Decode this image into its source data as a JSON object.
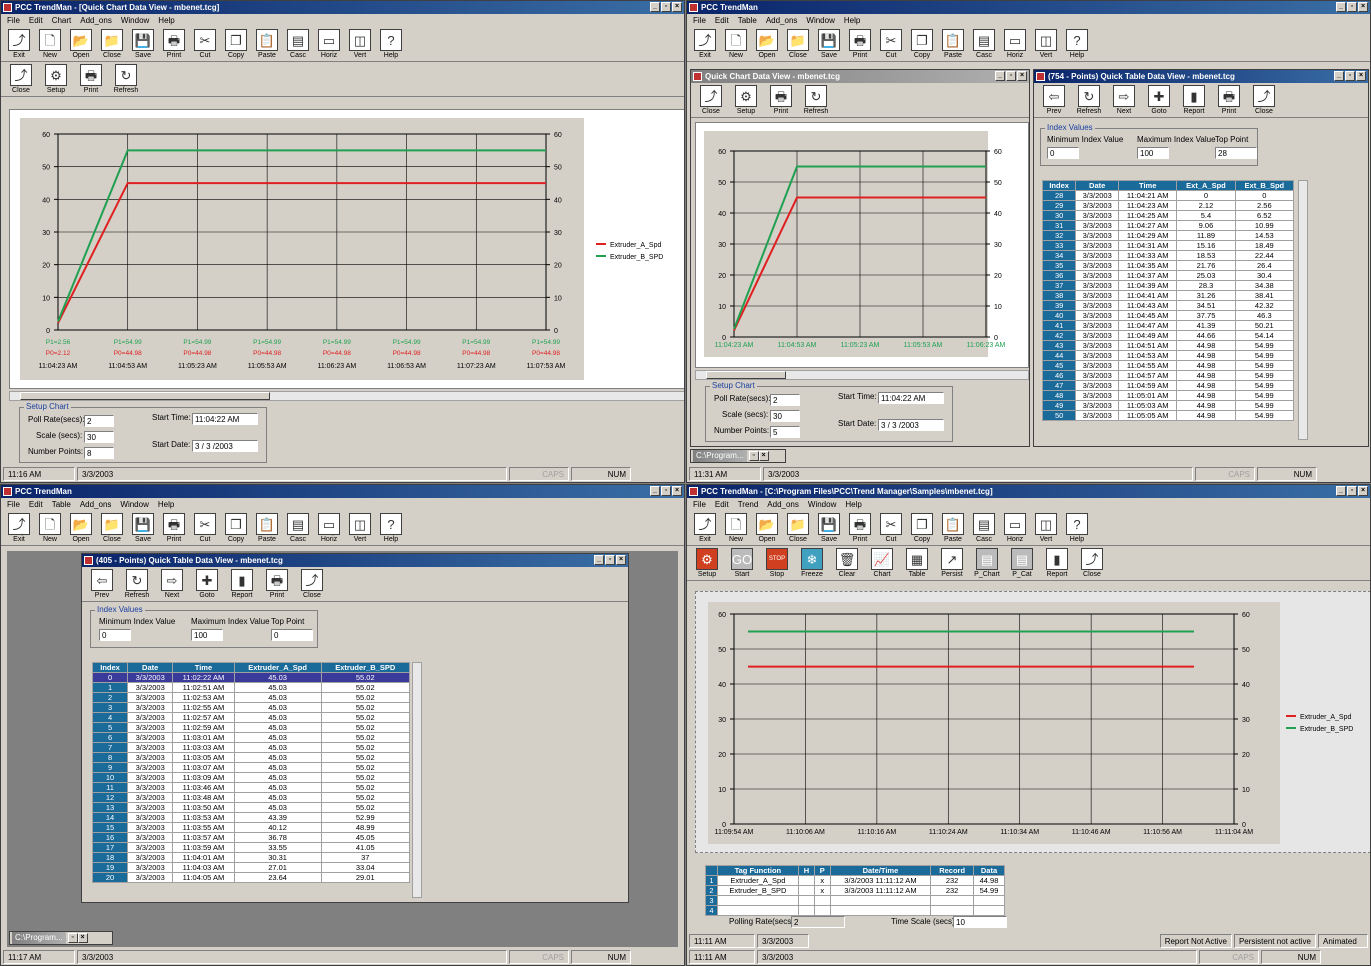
{
  "colors": {
    "series_a": "#e02020",
    "series_b": "#20a050",
    "accent": "#0a246a",
    "grid_header": "#1a6a9a"
  },
  "menus": {
    "q1": [
      "File",
      "Edit",
      "Chart",
      "Add_ons",
      "Window",
      "Help"
    ],
    "q2": [
      "File",
      "Edit",
      "Table",
      "Add_ons",
      "Window",
      "Help"
    ],
    "q3": [
      "File",
      "Edit",
      "Table",
      "Add_ons",
      "Window",
      "Help"
    ],
    "q4": [
      "File",
      "Edit",
      "Trend",
      "Add_ons",
      "Window",
      "Help"
    ]
  },
  "main_toolbar": [
    {
      "label": "Exit",
      "icon": "exit-icon",
      "glyph": "⤴"
    },
    {
      "label": "New",
      "icon": "new-icon",
      "glyph": "🗋"
    },
    {
      "label": "Open",
      "icon": "open-icon",
      "glyph": "📂"
    },
    {
      "label": "Close",
      "icon": "close-doc-icon",
      "glyph": "📁"
    },
    {
      "label": "Save",
      "icon": "save-icon",
      "glyph": "💾"
    },
    {
      "label": "Print",
      "icon": "print-icon",
      "glyph": "🖶"
    },
    {
      "label": "Cut",
      "icon": "cut-icon",
      "glyph": "✂"
    },
    {
      "label": "Copy",
      "icon": "copy-icon",
      "glyph": "❐"
    },
    {
      "label": "Paste",
      "icon": "paste-icon",
      "glyph": "📋"
    },
    {
      "label": "Casc",
      "icon": "cascade-icon",
      "glyph": "▤"
    },
    {
      "label": "Horiz",
      "icon": "tile-horizontal-icon",
      "glyph": "▭"
    },
    {
      "label": "Vert",
      "icon": "tile-vertical-icon",
      "glyph": "◫"
    },
    {
      "label": "Help",
      "icon": "help-icon",
      "glyph": "?"
    }
  ],
  "q1": {
    "title": "PCC TrendMan - [Quick Chart Data View - mbenet.tcg]",
    "chart_toolbar": [
      {
        "label": "Close",
        "icon": "close-icon",
        "glyph": "⤴"
      },
      {
        "label": "Setup",
        "icon": "setup-icon",
        "glyph": "⚙"
      },
      {
        "label": "Print",
        "icon": "print-icon",
        "glyph": "🖶"
      },
      {
        "label": "Refresh",
        "icon": "refresh-icon",
        "glyph": "↻"
      }
    ],
    "setup": {
      "legend": "Setup Chart",
      "poll_label": "Poll Rate(secs):",
      "poll": "2",
      "scale_label": "Scale (secs):",
      "scale": "30",
      "points_label": "Number Points:",
      "points": "8",
      "start_time_label": "Start Time:",
      "start_time": "11:04:22 AM",
      "start_date_label": "Start Date:",
      "start_date": "3 / 3 /2003"
    },
    "status": {
      "time": "11:16 AM",
      "date": "3/3/2003",
      "caps": "CAPS",
      "num": "NUM"
    }
  },
  "q2": {
    "title": "PCC TrendMan",
    "child_chart_title": "Quick Chart Data View - mbenet.tcg",
    "child_table_title": "(754 - Points) Quick Table Data View - mbenet.tcg",
    "chart_toolbar": [
      {
        "label": "Close",
        "icon": "close-icon",
        "glyph": "⤴"
      },
      {
        "label": "Setup",
        "icon": "setup-icon",
        "glyph": "⚙"
      },
      {
        "label": "Print",
        "icon": "print-icon",
        "glyph": "🖶"
      },
      {
        "label": "Refresh",
        "icon": "refresh-icon",
        "glyph": "↻"
      }
    ],
    "table_toolbar": [
      {
        "label": "Prev",
        "icon": "prev-arrow-icon",
        "glyph": "⇦"
      },
      {
        "label": "Refresh",
        "icon": "refresh-icon",
        "glyph": "↻"
      },
      {
        "label": "Next",
        "icon": "next-arrow-icon",
        "glyph": "⇨"
      },
      {
        "label": "Goto",
        "icon": "goto-icon",
        "glyph": "✚"
      },
      {
        "label": "Report",
        "icon": "report-icon",
        "glyph": "▮"
      },
      {
        "label": "Print",
        "icon": "print-icon",
        "glyph": "🖶"
      },
      {
        "label": "Close",
        "icon": "close-icon",
        "glyph": "⤴"
      }
    ],
    "index": {
      "legend": "Index Values",
      "min_label": "Minimum Index Value",
      "min": "0",
      "max_label": "Maximum Index Value",
      "max": "100",
      "top_label": "Top Point",
      "top": "28"
    },
    "setup": {
      "legend": "Setup Chart",
      "poll_label": "Poll Rate(secs):",
      "poll": "2",
      "scale_label": "Scale (secs):",
      "scale": "30",
      "points_label": "Number Points:",
      "points": "5",
      "start_time_label": "Start Time:",
      "start_time": "11:04:22 AM",
      "start_date_label": "Start Date:",
      "start_date": "3 / 3 /2003"
    },
    "table": {
      "headers": [
        "Index",
        "Date",
        "Time",
        "Ext_A_Spd",
        "Ext_B_Spd"
      ],
      "rows": [
        [
          "28",
          "3/3/2003",
          "11:04:21 AM",
          "0",
          "0"
        ],
        [
          "29",
          "3/3/2003",
          "11:04:23 AM",
          "2.12",
          "2.56"
        ],
        [
          "30",
          "3/3/2003",
          "11:04:25 AM",
          "5.4",
          "6.52"
        ],
        [
          "31",
          "3/3/2003",
          "11:04:27 AM",
          "9.06",
          "10.99"
        ],
        [
          "32",
          "3/3/2003",
          "11:04:29 AM",
          "11.89",
          "14.53"
        ],
        [
          "33",
          "3/3/2003",
          "11:04:31 AM",
          "15.16",
          "18.49"
        ],
        [
          "34",
          "3/3/2003",
          "11:04:33 AM",
          "18.53",
          "22.44"
        ],
        [
          "35",
          "3/3/2003",
          "11:04:35 AM",
          "21.76",
          "26.4"
        ],
        [
          "36",
          "3/3/2003",
          "11:04:37 AM",
          "25.03",
          "30.4"
        ],
        [
          "37",
          "3/3/2003",
          "11:04:39 AM",
          "28.3",
          "34.38"
        ],
        [
          "38",
          "3/3/2003",
          "11:04:41 AM",
          "31.26",
          "38.41"
        ],
        [
          "39",
          "3/3/2003",
          "11:04:43 AM",
          "34.51",
          "42.32"
        ],
        [
          "40",
          "3/3/2003",
          "11:04:45 AM",
          "37.75",
          "46.3"
        ],
        [
          "41",
          "3/3/2003",
          "11:04:47 AM",
          "41.39",
          "50.21"
        ],
        [
          "42",
          "3/3/2003",
          "11:04:49 AM",
          "44.66",
          "54.14"
        ],
        [
          "43",
          "3/3/2003",
          "11:04:51 AM",
          "44.98",
          "54.99"
        ],
        [
          "44",
          "3/3/2003",
          "11:04:53 AM",
          "44.98",
          "54.99"
        ],
        [
          "45",
          "3/3/2003",
          "11:04:55 AM",
          "44.98",
          "54.99"
        ],
        [
          "46",
          "3/3/2003",
          "11:04:57 AM",
          "44.98",
          "54.99"
        ],
        [
          "47",
          "3/3/2003",
          "11:04:59 AM",
          "44.98",
          "54.99"
        ],
        [
          "48",
          "3/3/2003",
          "11:05:01 AM",
          "44.98",
          "54.99"
        ],
        [
          "49",
          "3/3/2003",
          "11:05:03 AM",
          "44.98",
          "54.99"
        ],
        [
          "50",
          "3/3/2003",
          "11:05:05 AM",
          "44.98",
          "54.99"
        ]
      ]
    },
    "minimized": "C:\\Program...",
    "status": {
      "time": "11:31 AM",
      "date": "3/3/2003",
      "caps": "CAPS",
      "num": "NUM"
    }
  },
  "q3": {
    "title": "PCC TrendMan",
    "child_table_title": "(405 - Points) Quick Table Data View - mbenet.tcg",
    "table_toolbar": [
      {
        "label": "Prev",
        "icon": "prev-arrow-icon",
        "glyph": "⇦"
      },
      {
        "label": "Refresh",
        "icon": "refresh-icon",
        "glyph": "↻"
      },
      {
        "label": "Next",
        "icon": "next-arrow-icon",
        "glyph": "⇨"
      },
      {
        "label": "Goto",
        "icon": "goto-icon",
        "glyph": "✚"
      },
      {
        "label": "Report",
        "icon": "report-icon",
        "glyph": "▮"
      },
      {
        "label": "Print",
        "icon": "print-icon",
        "glyph": "🖶"
      },
      {
        "label": "Close",
        "icon": "close-icon",
        "glyph": "⤴"
      }
    ],
    "index": {
      "legend": "Index Values",
      "min_label": "Minimum Index Value",
      "min": "0",
      "max_label": "Maximum Index Value",
      "max": "100",
      "top_label": "Top Point",
      "top": "0"
    },
    "table": {
      "headers": [
        "Index",
        "Date",
        "Time",
        "Extruder_A_Spd",
        "Extruder_B_SPD"
      ],
      "rows": [
        [
          "0",
          "3/3/2003",
          "11:02:22 AM",
          "45.03",
          "55.02"
        ],
        [
          "1",
          "3/3/2003",
          "11:02:51 AM",
          "45.03",
          "55.02"
        ],
        [
          "2",
          "3/3/2003",
          "11:02:53 AM",
          "45.03",
          "55.02"
        ],
        [
          "3",
          "3/3/2003",
          "11:02:55 AM",
          "45.03",
          "55.02"
        ],
        [
          "4",
          "3/3/2003",
          "11:02:57 AM",
          "45.03",
          "55.02"
        ],
        [
          "5",
          "3/3/2003",
          "11:02:59 AM",
          "45.03",
          "55.02"
        ],
        [
          "6",
          "3/3/2003",
          "11:03:01 AM",
          "45.03",
          "55.02"
        ],
        [
          "7",
          "3/3/2003",
          "11:03:03 AM",
          "45.03",
          "55.02"
        ],
        [
          "8",
          "3/3/2003",
          "11:03:05 AM",
          "45.03",
          "55.02"
        ],
        [
          "9",
          "3/3/2003",
          "11:03:07 AM",
          "45.03",
          "55.02"
        ],
        [
          "10",
          "3/3/2003",
          "11:03:09 AM",
          "45.03",
          "55.02"
        ],
        [
          "11",
          "3/3/2003",
          "11:03:46 AM",
          "45.03",
          "55.02"
        ],
        [
          "12",
          "3/3/2003",
          "11:03:48 AM",
          "45.03",
          "55.02"
        ],
        [
          "13",
          "3/3/2003",
          "11:03:50 AM",
          "45.03",
          "55.02"
        ],
        [
          "14",
          "3/3/2003",
          "11:03:53 AM",
          "43.39",
          "52.99"
        ],
        [
          "15",
          "3/3/2003",
          "11:03:55 AM",
          "40.12",
          "48.99"
        ],
        [
          "16",
          "3/3/2003",
          "11:03:57 AM",
          "36.78",
          "45.05"
        ],
        [
          "17",
          "3/3/2003",
          "11:03:59 AM",
          "33.55",
          "41.05"
        ],
        [
          "18",
          "3/3/2003",
          "11:04:01 AM",
          "30.31",
          "37"
        ],
        [
          "19",
          "3/3/2003",
          "11:04:03 AM",
          "27.01",
          "33.04"
        ],
        [
          "20",
          "3/3/2003",
          "11:04:05 AM",
          "23.64",
          "29.01"
        ]
      ]
    },
    "minimized": "C:\\Program...",
    "status": {
      "time": "11:17 AM",
      "date": "3/3/2003",
      "caps": "CAPS",
      "num": "NUM"
    }
  },
  "q4": {
    "title": "PCC TrendMan - [C:\\Program Files\\PCC\\Trend Manager\\Samples\\mbenet.tcg]",
    "trend_toolbar": [
      {
        "label": "Setup",
        "icon": "setup-icon",
        "glyph": "⚙",
        "style": "red"
      },
      {
        "label": "Start",
        "icon": "go-icon",
        "glyph": "GO",
        "style": "gray"
      },
      {
        "label": "Stop",
        "icon": "stop-icon",
        "glyph": "STOP",
        "style": "red"
      },
      {
        "label": "Freeze",
        "icon": "freeze-icon",
        "glyph": "❄",
        "style": "teal"
      },
      {
        "label": "Clear",
        "icon": "clear-icon",
        "glyph": "🗑",
        "style": ""
      },
      {
        "label": "Chart",
        "icon": "chart-icon",
        "glyph": "📈",
        "style": ""
      },
      {
        "label": "Table",
        "icon": "table-icon",
        "glyph": "▦",
        "style": ""
      },
      {
        "label": "Persist",
        "icon": "persist-icon",
        "glyph": "↗",
        "style": ""
      },
      {
        "label": "P_Chart",
        "icon": "p-chart-icon",
        "glyph": "▤",
        "style": "gray"
      },
      {
        "label": "P_Cat",
        "icon": "p-cat-icon",
        "glyph": "▤",
        "style": "gray"
      },
      {
        "label": "Report",
        "icon": "report-icon",
        "glyph": "▮",
        "style": ""
      },
      {
        "label": "Close",
        "icon": "close-icon",
        "glyph": "⤴",
        "style": ""
      }
    ],
    "tags": {
      "headers": [
        "Tag Function",
        "H",
        "P",
        "Date/Time",
        "Record",
        "Data"
      ],
      "rows": [
        [
          "1",
          "Extruder_A_Spd",
          "",
          "x",
          "3/3/2003 11:11:12 AM",
          "232",
          "44.98"
        ],
        [
          "2",
          "Extruder_B_SPD",
          "",
          "x",
          "3/3/2003 11:11:12 AM",
          "232",
          "54.99"
        ],
        [
          "3",
          "",
          "",
          "",
          "",
          "",
          ""
        ],
        [
          "4",
          "",
          "",
          "",
          "",
          "",
          ""
        ]
      ]
    },
    "poll_label": "Polling Rate(secs):",
    "poll": "2",
    "timescale_label": "Time Scale (secs):",
    "timescale": "10",
    "status1": {
      "time": "11:11 AM",
      "date": "3/3/2003",
      "report": "Report Not Active",
      "persist": "Persistent not active",
      "anim": "Animated"
    },
    "status2": {
      "time": "11:11 AM",
      "date": "3/3/2003",
      "caps": "CAPS",
      "num": "NUM"
    }
  },
  "chart_data": [
    {
      "type": "line",
      "ylim": [
        0,
        60
      ],
      "yticks": [
        0,
        10,
        20,
        30,
        40,
        50,
        60
      ],
      "x": [
        "11:04:23 AM",
        "11:04:53 AM",
        "11:05:23 AM",
        "11:05:53 AM",
        "11:06:23 AM",
        "11:06:53 AM",
        "11:07:23 AM",
        "11:07:53 AM"
      ],
      "p1_labels": [
        "P1=2.56",
        "P1=54.99",
        "P1=54.99",
        "P1=54.99",
        "P1=54.99",
        "P1=54.99",
        "P1=54.99",
        "P1=54.99"
      ],
      "p0_labels": [
        "P0=2.12",
        "P0=44.98",
        "P0=44.98",
        "P0=44.98",
        "P0=44.98",
        "P0=44.98",
        "P0=44.98",
        "P0=44.98"
      ],
      "series": [
        {
          "name": "Extruder_A_Spd",
          "values": [
            2.12,
            44.98,
            44.98,
            44.98,
            44.98,
            44.98,
            44.98,
            44.98
          ]
        },
        {
          "name": "Extruder_B_SPD",
          "values": [
            2.56,
            54.99,
            54.99,
            54.99,
            54.99,
            54.99,
            54.99,
            54.99
          ]
        }
      ],
      "legend": "right",
      "grid": true
    },
    {
      "type": "line",
      "ylim": [
        0,
        60
      ],
      "yticks": [
        0,
        10,
        20,
        30,
        40,
        50,
        60
      ],
      "x": [
        "11:04:23 AM",
        "11:04:53 AM",
        "11:05:23 AM",
        "11:05:53 AM",
        "11:06:23 AM"
      ],
      "series": [
        {
          "name": "Extruder_A_Spd",
          "values": [
            2.12,
            44.98,
            44.98,
            44.98,
            44.98
          ]
        },
        {
          "name": "Extruder_B_SPD",
          "values": [
            2.56,
            54.99,
            54.99,
            54.99,
            54.99
          ]
        }
      ],
      "legend": "none",
      "grid": true
    },
    {
      "type": "line",
      "ylim": [
        0,
        60
      ],
      "yticks": [
        0,
        10,
        20,
        30,
        40,
        50,
        60
      ],
      "x": [
        "11:09:54 AM",
        "11:10:06 AM",
        "11:10:16 AM",
        "11:10:24 AM",
        "11:10:34 AM",
        "11:10:46 AM",
        "11:10:56 AM",
        "11:11:04 AM"
      ],
      "series": [
        {
          "name": "Extruder_A_Spd",
          "values": [
            44.98,
            44.98,
            44.98,
            44.98,
            44.98,
            44.98,
            44.98,
            44.98
          ]
        },
        {
          "name": "Extruder_B_SPD",
          "values": [
            54.99,
            54.99,
            54.99,
            54.99,
            54.99,
            54.99,
            54.99,
            54.99
          ]
        }
      ],
      "legend": "right",
      "grid": true
    }
  ]
}
